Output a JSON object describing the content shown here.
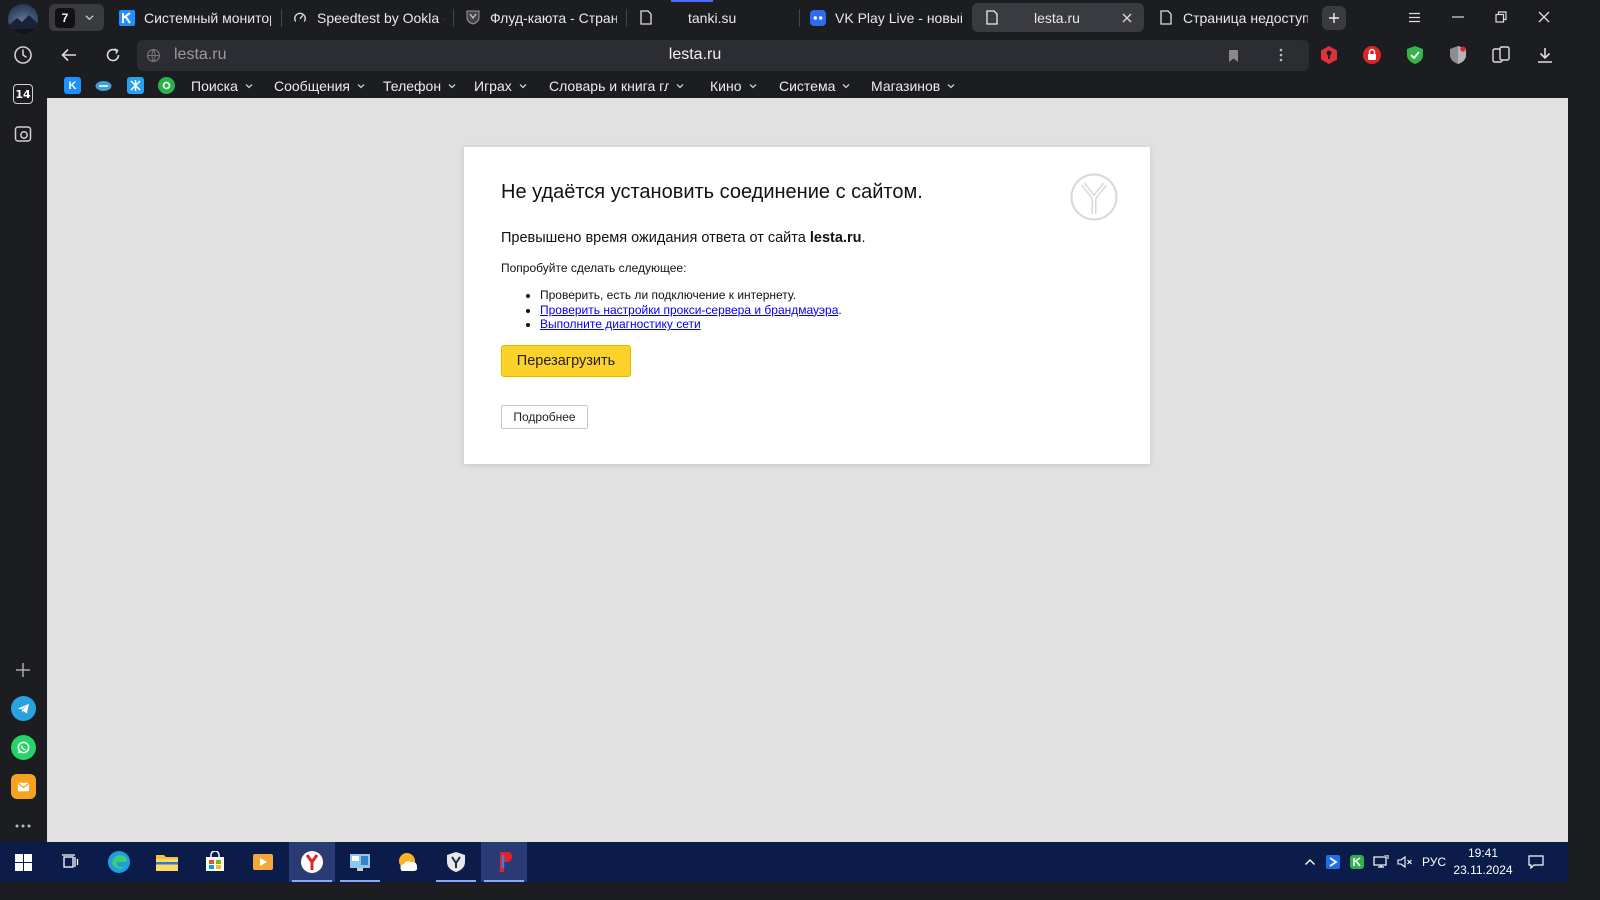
{
  "browser": {
    "tab_counter": "7",
    "tabs": [
      {
        "title": "Системный монитор",
        "icon": "kaspersky-k-icon",
        "active": false
      },
      {
        "title": "Speedtest by Ookla - T",
        "icon": "speedtest-icon",
        "active": false
      },
      {
        "title": "Флуд-каюта - Страни",
        "icon": "forum-shield-icon",
        "active": false
      },
      {
        "title": "tanki.su",
        "icon": "page-icon",
        "active": false
      },
      {
        "title": "VK Play Live - новый г",
        "icon": "vk-play-icon",
        "active": false
      },
      {
        "title": "lesta.ru",
        "icon": "page-icon",
        "active": true
      },
      {
        "title": "Страница недоступна",
        "icon": "page-icon",
        "active": false
      }
    ],
    "address": {
      "url_text": "lesta.ru",
      "page_title": "lesta.ru"
    },
    "sidebar": {
      "calendar_day": "14"
    },
    "bookmarks": [
      {
        "label": "Поиска"
      },
      {
        "label": "Сообщения"
      },
      {
        "label": "Телефон"
      },
      {
        "label": "Играх"
      },
      {
        "label": "Словарь и книга глу"
      },
      {
        "label": "Кино"
      },
      {
        "label": "Система"
      },
      {
        "label": "Магазинов"
      }
    ]
  },
  "error_page": {
    "title": "Не удаётся установить соединение с сайтом.",
    "desc_prefix": "Превышено время ожидания ответа от сайта ",
    "desc_host": "lesta.ru",
    "desc_suffix": ".",
    "try_label": "Попробуйте сделать следующее:",
    "suggestions": [
      {
        "text": "Проверить, есть ли подключение к интернету.",
        "link": false,
        "suffix": ""
      },
      {
        "text": "Проверить настройки прокси-сервера и брандмауэра",
        "link": true,
        "suffix": "."
      },
      {
        "text": "Выполните диагностику сети",
        "link": true,
        "suffix": ""
      }
    ],
    "reload_label": "Перезагрузить",
    "details_label": "Подробнее"
  },
  "taskbar": {
    "language": "РУС",
    "time": "19:41",
    "date": "23.11.2024"
  },
  "colors": {
    "accent_yellow": "#fdd32b",
    "link_blue": "#0000ee",
    "content_bg": "#e1e1e1",
    "browser_chrome": "#1c1d21",
    "taskbar_bg": "#0b1b4a"
  }
}
